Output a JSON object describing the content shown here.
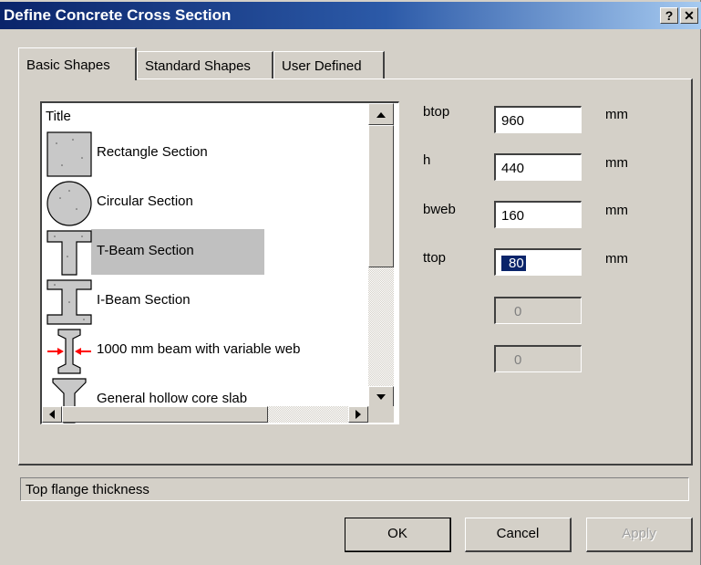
{
  "window": {
    "title": "Define Concrete Cross Section",
    "help_label": "?",
    "close_label": "✕"
  },
  "tabs": [
    {
      "label": "Basic Shapes",
      "active": true
    },
    {
      "label": "Standard Shapes",
      "active": false
    },
    {
      "label": "User Defined",
      "active": false
    }
  ],
  "list": {
    "header": "Title",
    "items": [
      {
        "label": "Rectangle Section",
        "icon": "rectangle-section-icon"
      },
      {
        "label": "Circular Section",
        "icon": "circular-section-icon"
      },
      {
        "label": "T-Beam Section",
        "icon": "t-beam-section-icon",
        "selected": true
      },
      {
        "label": "I-Beam Section",
        "icon": "i-beam-section-icon"
      },
      {
        "label": "1000 mm beam with variable web",
        "icon": "variable-web-beam-icon"
      },
      {
        "label": "General hollow core slab",
        "icon": "hollow-core-slab-icon"
      }
    ]
  },
  "params": [
    {
      "label": "btop",
      "value": "960",
      "unit": "mm"
    },
    {
      "label": "h",
      "value": "440",
      "unit": "mm"
    },
    {
      "label": "bweb",
      "value": "160",
      "unit": "mm"
    },
    {
      "label": "ttop",
      "value": "80",
      "unit": "mm"
    },
    {
      "label": "",
      "value": "0",
      "unit": ""
    },
    {
      "label": "",
      "value": "0",
      "unit": ""
    }
  ],
  "status": "Top flange thickness",
  "buttons": {
    "ok": "OK",
    "cancel": "Cancel",
    "apply": "Apply"
  },
  "colors": {
    "title_bar": "#0a246a",
    "selection": "#0a246a",
    "dialog_bg": "#d4d0c8",
    "arrow": "#ff0000"
  }
}
